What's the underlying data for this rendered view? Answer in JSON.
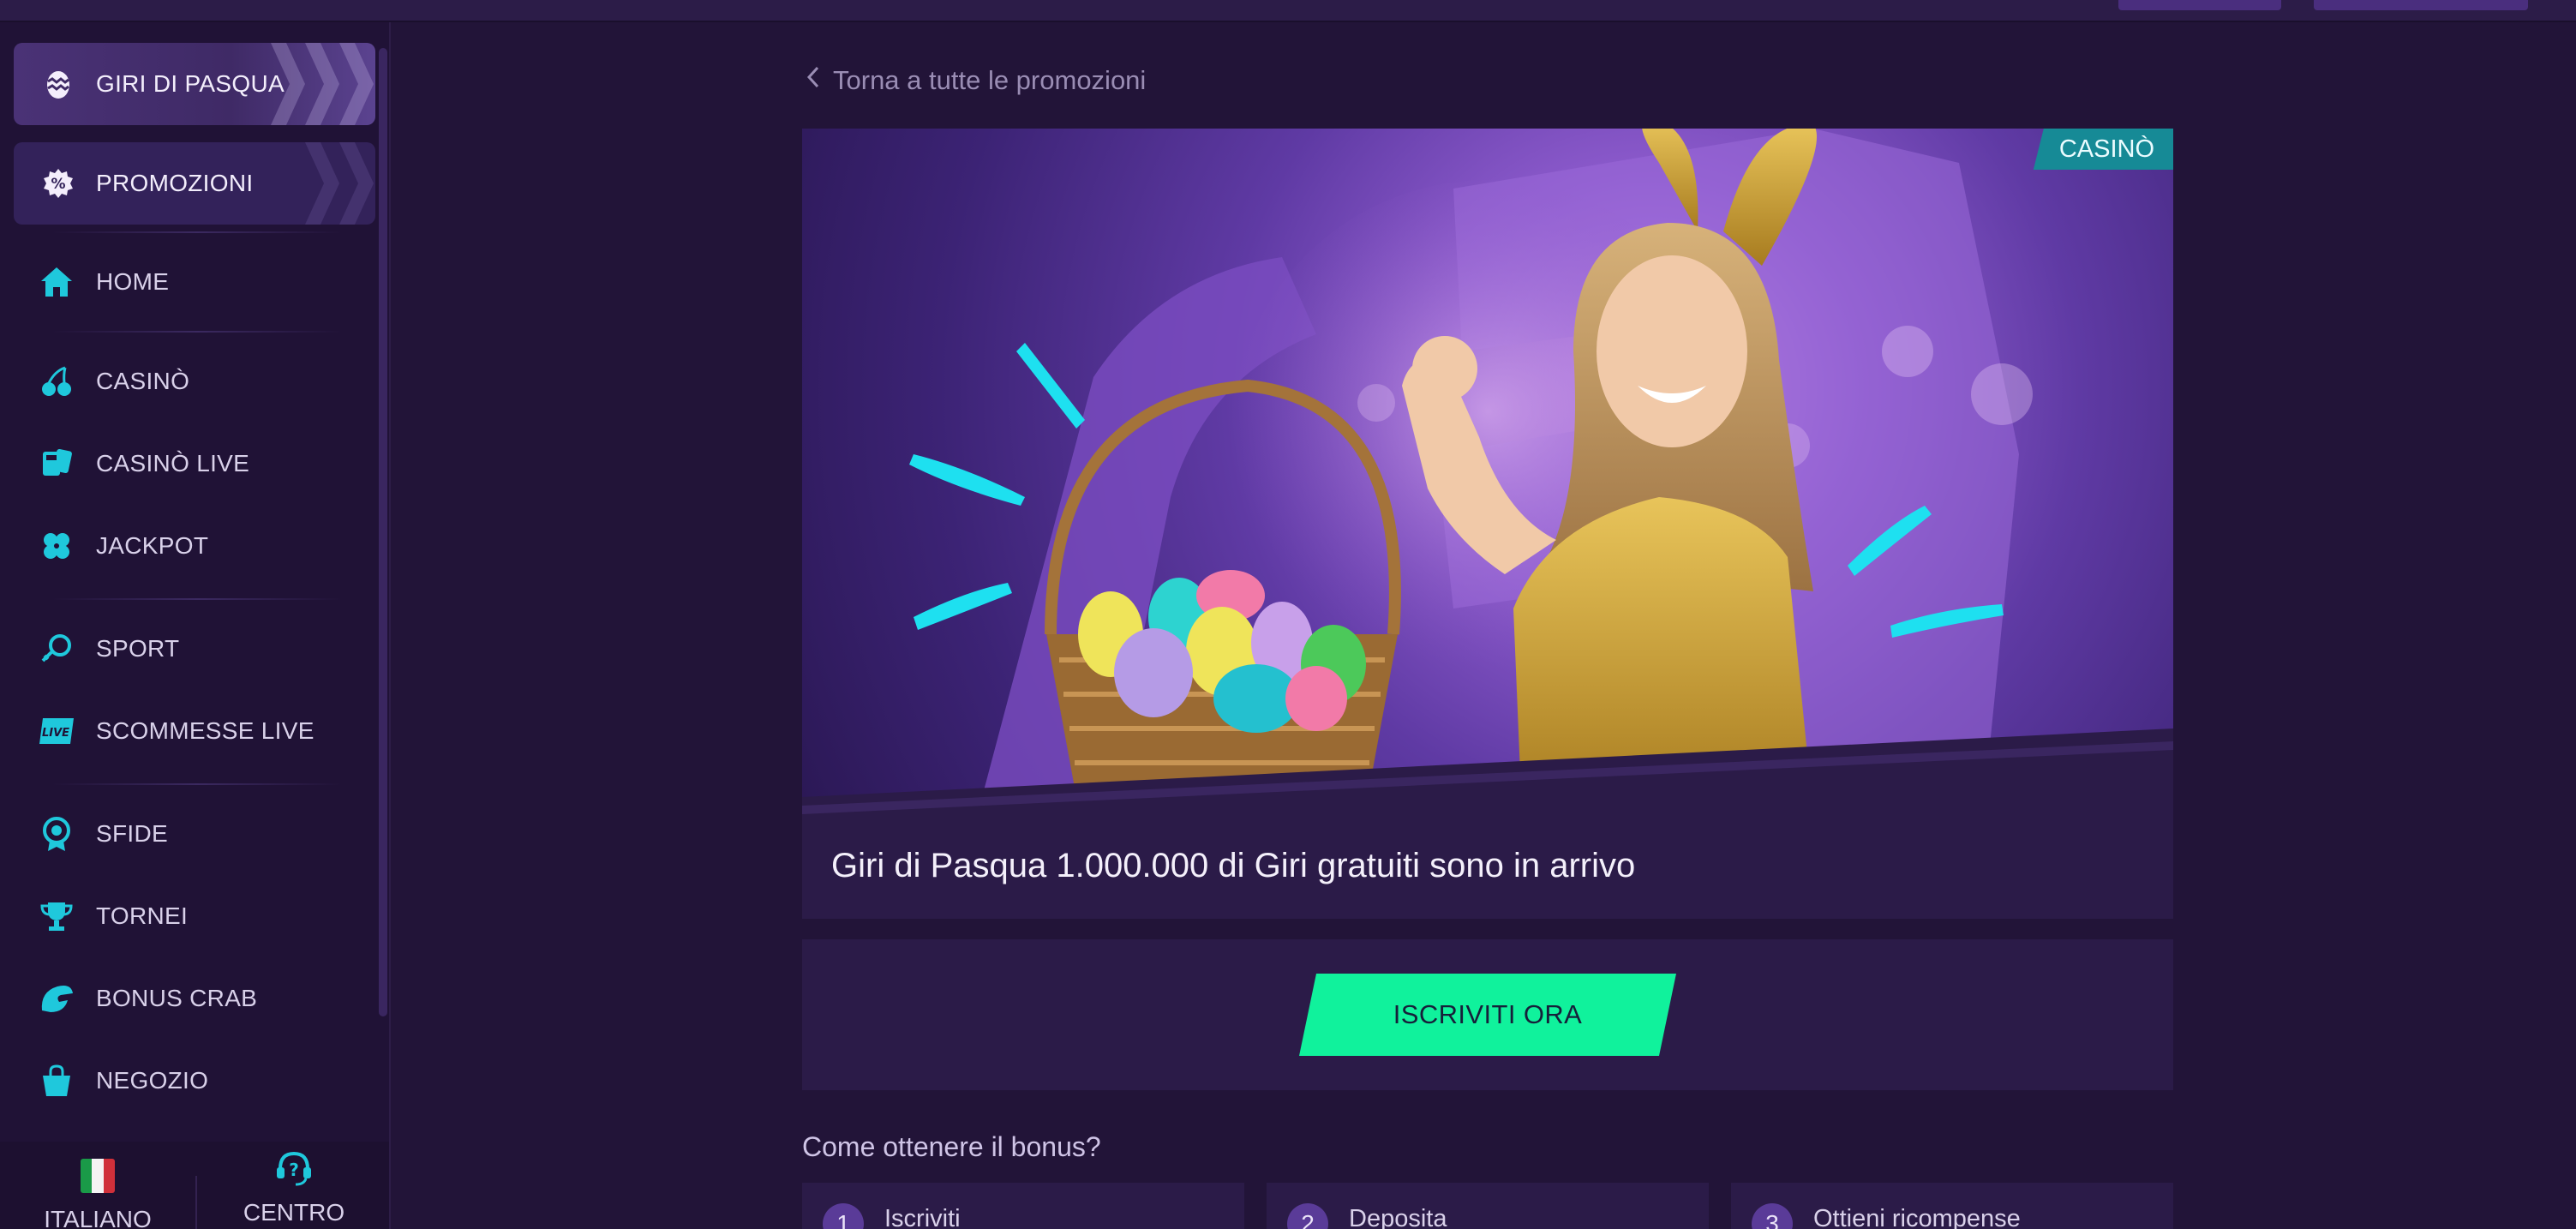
{
  "sidebar": {
    "promo_pills": [
      {
        "label": "GIRI DI PASQUA",
        "icon": "easter-egg-icon"
      },
      {
        "label": "PROMOZIONI",
        "icon": "percent-badge-icon"
      }
    ],
    "items": [
      {
        "label": "HOME",
        "icon": "home-icon"
      },
      {
        "label": "CASINÒ",
        "icon": "cherries-icon"
      },
      {
        "label": "CASINÒ LIVE",
        "icon": "cards-icon"
      },
      {
        "label": "JACKPOT",
        "icon": "clover-icon"
      },
      {
        "label": "SPORT",
        "icon": "sport-ball-icon"
      },
      {
        "label": "SCOMMESSE LIVE",
        "icon": "live-badge-icon"
      },
      {
        "label": "SFIDE",
        "icon": "badge-icon"
      },
      {
        "label": "TORNEI",
        "icon": "trophy-icon"
      },
      {
        "label": "BONUS CRAB",
        "icon": "crab-claw-icon"
      },
      {
        "label": "NEGOZIO",
        "icon": "shopping-bag-icon"
      }
    ],
    "language": {
      "label": "ITALIANO",
      "icon": "italy-flag-icon"
    },
    "help": {
      "label": "CENTRO ASSISTENZA",
      "icon": "help-headset-icon"
    }
  },
  "main": {
    "back_link": "Torna a tutte le promozioni",
    "banner": {
      "tag": "CASINÒ",
      "title": "Giri di Pasqua 1.000.000 di Giri gratuiti sono in arrivo"
    },
    "cta_label": "ISCRIVITI ORA",
    "how_title": "Come ottenere il bonus?",
    "steps": [
      {
        "num": "1",
        "label": "Iscriviti"
      },
      {
        "num": "2",
        "label": "Deposita"
      },
      {
        "num": "3",
        "label": "Ottieni ricompense"
      }
    ]
  },
  "colors": {
    "background": "#221438",
    "sidebar": "#201236",
    "accent_cyan": "#1fc8dc",
    "cta_green": "#10f29c",
    "tag_teal": "#168a96"
  }
}
